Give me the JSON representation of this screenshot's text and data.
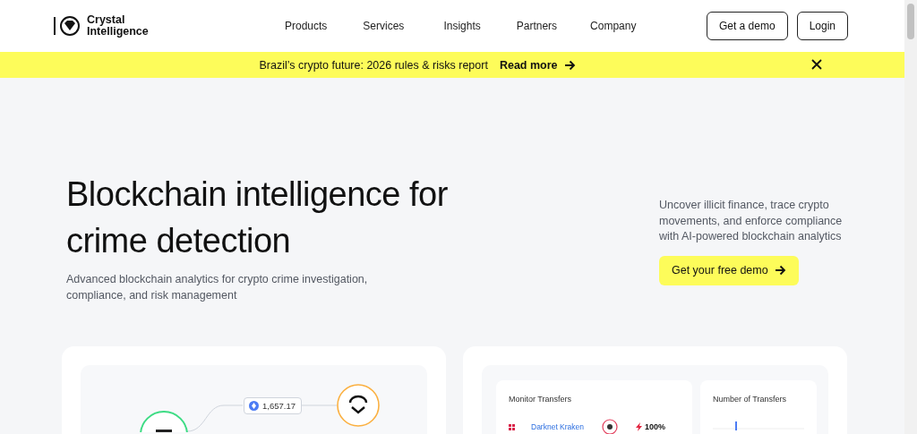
{
  "logo": {
    "name": "Crystal Intelligence"
  },
  "nav": [
    "Products",
    "Services",
    "Insights",
    "Partners",
    "Company"
  ],
  "header_buttons": [
    {
      "label": "Get a demo"
    },
    {
      "label": "Login"
    }
  ],
  "banner": {
    "text": "Brazil’s crypto future: 2026 rules & risks report",
    "link": "Read more"
  },
  "hero": {
    "title": "Blockchain intelligence for crime detection",
    "subtitle": "Advanced blockchain analytics for crypto crime investigation, compliance, and risk management",
    "side_text": "Uncover illicit finance, trace crypto movements, and enforce compliance with AI-powered blockchain analytics",
    "cta": "Get your free demo"
  },
  "flow_card": {
    "amount": "1,657.17"
  },
  "monitor_card": {
    "title": "Monitor Transfers",
    "rows": [
      {
        "name": "Darknet Kraken",
        "risk": "100%"
      }
    ],
    "chart_title": "Number of Transfers"
  }
}
